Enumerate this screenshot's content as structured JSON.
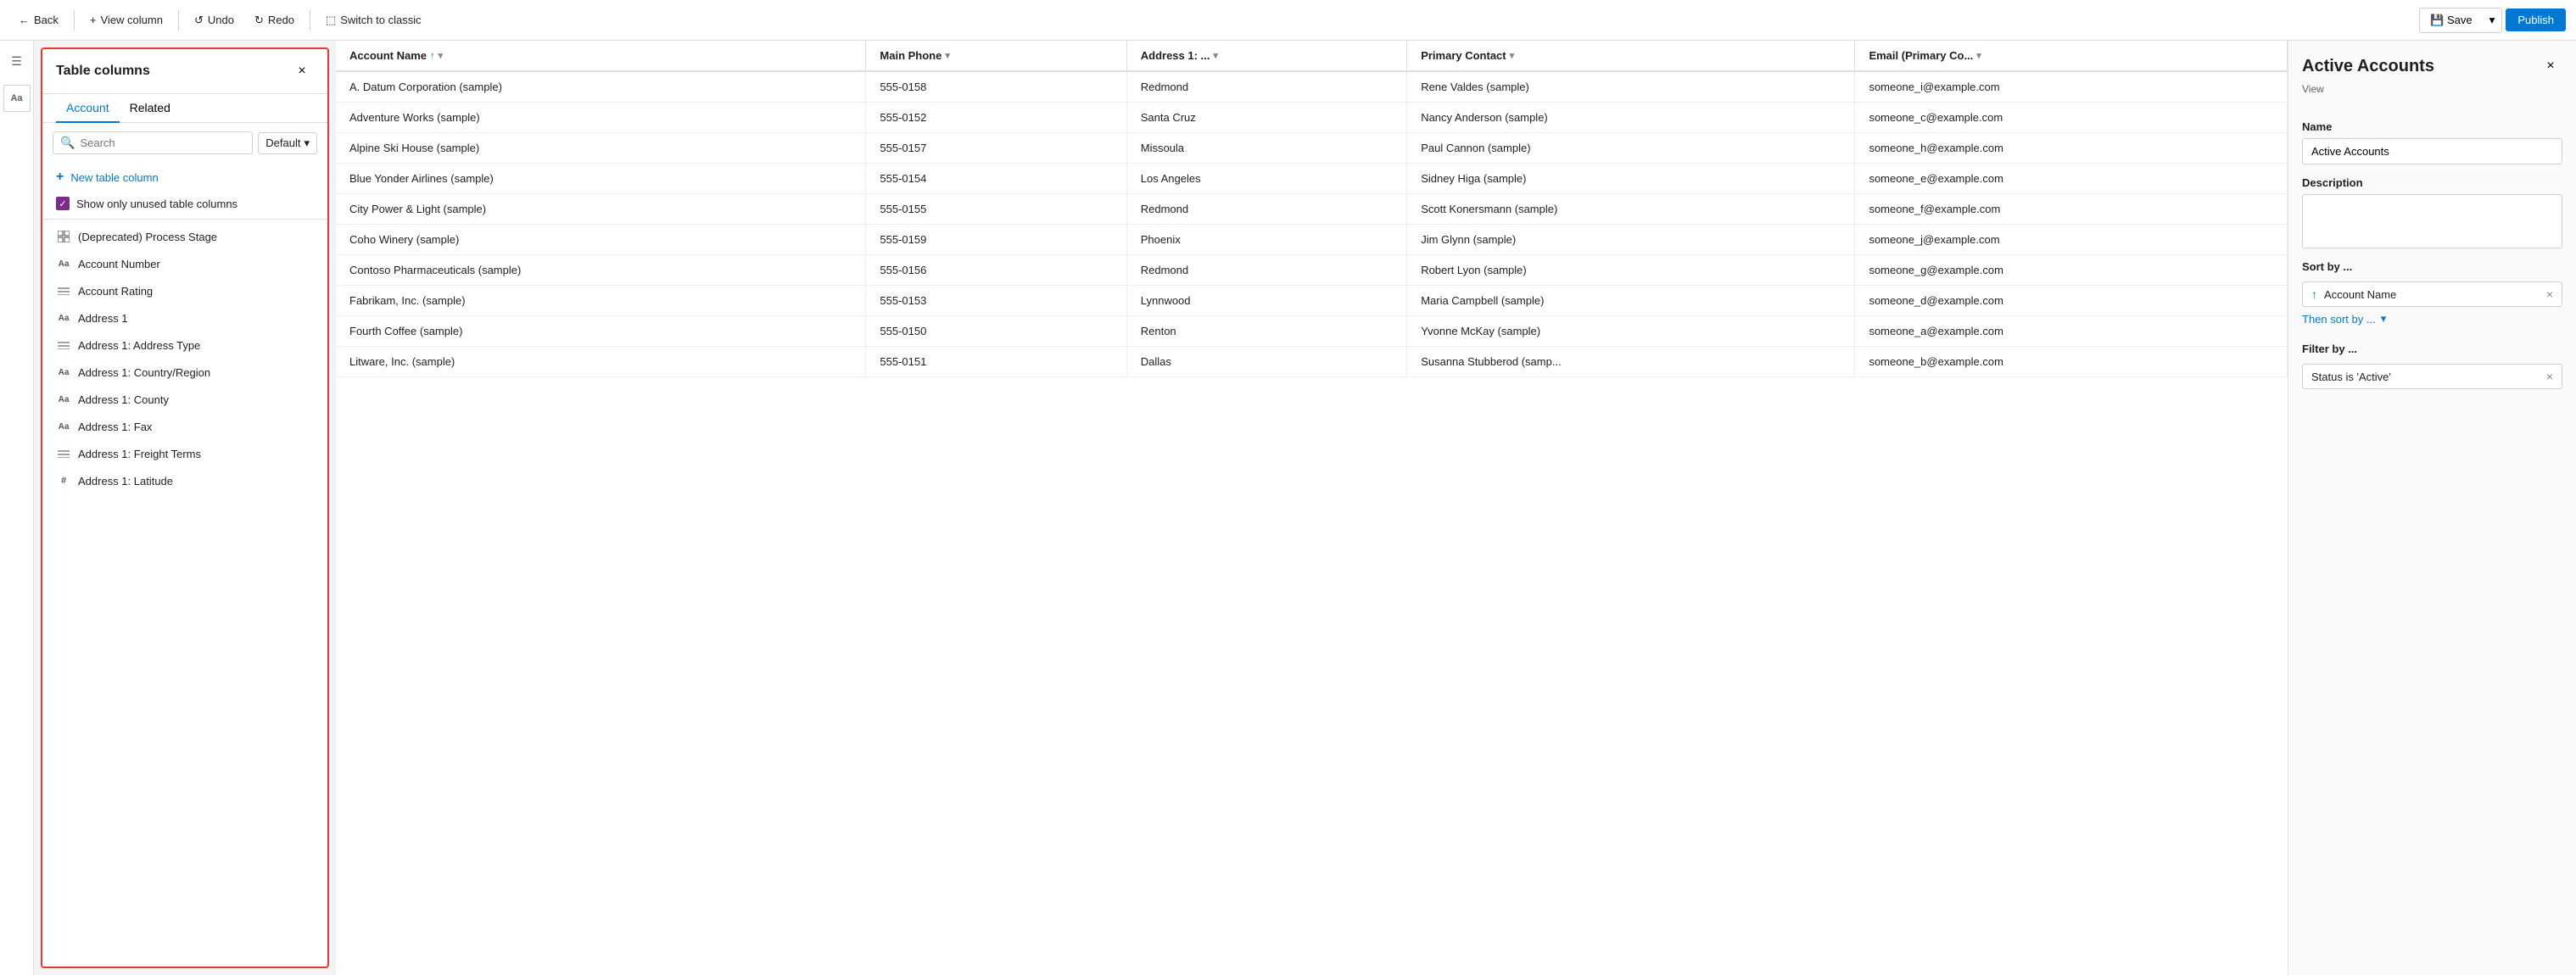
{
  "toolbar": {
    "back_label": "Back",
    "view_column_label": "View column",
    "undo_label": "Undo",
    "redo_label": "Redo",
    "switch_label": "Switch to classic",
    "save_label": "Save",
    "publish_label": "Publish"
  },
  "columns_panel": {
    "title": "Table columns",
    "close_icon": "×",
    "tabs": [
      {
        "label": "Account",
        "active": true
      },
      {
        "label": "Related",
        "active": false
      }
    ],
    "search_placeholder": "Search",
    "default_dropdown": "Default",
    "new_col_label": "New table column",
    "checkbox_label": "Show only unused table columns",
    "columns": [
      {
        "label": "(Deprecated) Process Stage",
        "icon_type": "grid"
      },
      {
        "label": "Account Number",
        "icon_type": "text"
      },
      {
        "label": "Account Rating",
        "icon_type": "choice"
      },
      {
        "label": "Address 1",
        "icon_type": "text"
      },
      {
        "label": "Address 1: Address Type",
        "icon_type": "choice"
      },
      {
        "label": "Address 1: Country/Region",
        "icon_type": "text"
      },
      {
        "label": "Address 1: County",
        "icon_type": "text"
      },
      {
        "label": "Address 1: Fax",
        "icon_type": "text"
      },
      {
        "label": "Address 1: Freight Terms",
        "icon_type": "choice"
      },
      {
        "label": "Address 1: Latitude",
        "icon_type": "number"
      }
    ]
  },
  "table": {
    "columns": [
      {
        "label": "Account Name",
        "sort": "asc",
        "has_dropdown": true
      },
      {
        "label": "Main Phone",
        "sort": null,
        "has_dropdown": true
      },
      {
        "label": "Address 1: ...",
        "sort": null,
        "has_dropdown": true
      },
      {
        "label": "Primary Contact",
        "sort": null,
        "has_dropdown": true
      },
      {
        "label": "Email (Primary Co...",
        "sort": null,
        "has_dropdown": true
      }
    ],
    "rows": [
      {
        "account_name": "A. Datum Corporation (sample)",
        "main_phone": "555-0158",
        "address": "Redmond",
        "primary_contact": "Rene Valdes (sample)",
        "email": "someone_i@example.com"
      },
      {
        "account_name": "Adventure Works (sample)",
        "main_phone": "555-0152",
        "address": "Santa Cruz",
        "primary_contact": "Nancy Anderson (sample)",
        "email": "someone_c@example.com"
      },
      {
        "account_name": "Alpine Ski House (sample)",
        "main_phone": "555-0157",
        "address": "Missoula",
        "primary_contact": "Paul Cannon (sample)",
        "email": "someone_h@example.com"
      },
      {
        "account_name": "Blue Yonder Airlines (sample)",
        "main_phone": "555-0154",
        "address": "Los Angeles",
        "primary_contact": "Sidney Higa (sample)",
        "email": "someone_e@example.com"
      },
      {
        "account_name": "City Power & Light (sample)",
        "main_phone": "555-0155",
        "address": "Redmond",
        "primary_contact": "Scott Konersmann (sample)",
        "email": "someone_f@example.com"
      },
      {
        "account_name": "Coho Winery (sample)",
        "main_phone": "555-0159",
        "address": "Phoenix",
        "primary_contact": "Jim Glynn (sample)",
        "email": "someone_j@example.com"
      },
      {
        "account_name": "Contoso Pharmaceuticals (sample)",
        "main_phone": "555-0156",
        "address": "Redmond",
        "primary_contact": "Robert Lyon (sample)",
        "email": "someone_g@example.com"
      },
      {
        "account_name": "Fabrikam, Inc. (sample)",
        "main_phone": "555-0153",
        "address": "Lynnwood",
        "primary_contact": "Maria Campbell (sample)",
        "email": "someone_d@example.com"
      },
      {
        "account_name": "Fourth Coffee (sample)",
        "main_phone": "555-0150",
        "address": "Renton",
        "primary_contact": "Yvonne McKay (sample)",
        "email": "someone_a@example.com"
      },
      {
        "account_name": "Litware, Inc. (sample)",
        "main_phone": "555-0151",
        "address": "Dallas",
        "primary_contact": "Susanna Stubberod (samp...",
        "email": "someone_b@example.com"
      }
    ]
  },
  "right_panel": {
    "title": "Active Accounts",
    "view_label": "View",
    "name_label": "Name",
    "name_value": "Active Accounts",
    "description_label": "Description",
    "description_value": "",
    "sort_label": "Sort by ...",
    "sort_field": "Account Name",
    "sort_direction_icon": "↑",
    "then_sort_label": "Then sort by ...",
    "filter_label": "Filter by ...",
    "filter_value": "Status is 'Active'"
  },
  "icons": {
    "back": "←",
    "view_column": "+",
    "undo": "↺",
    "redo": "↻",
    "switch": "⬚",
    "save_floppy": "💾",
    "chevron_down": "▾",
    "close": "×",
    "sort_asc": "↑",
    "plus": "+",
    "check": "✓",
    "search": "🔍",
    "hamburger": "☰",
    "text_icon": "Aa",
    "grid_icon": "⊞",
    "choice_icon": "☰",
    "number_icon": "#"
  }
}
